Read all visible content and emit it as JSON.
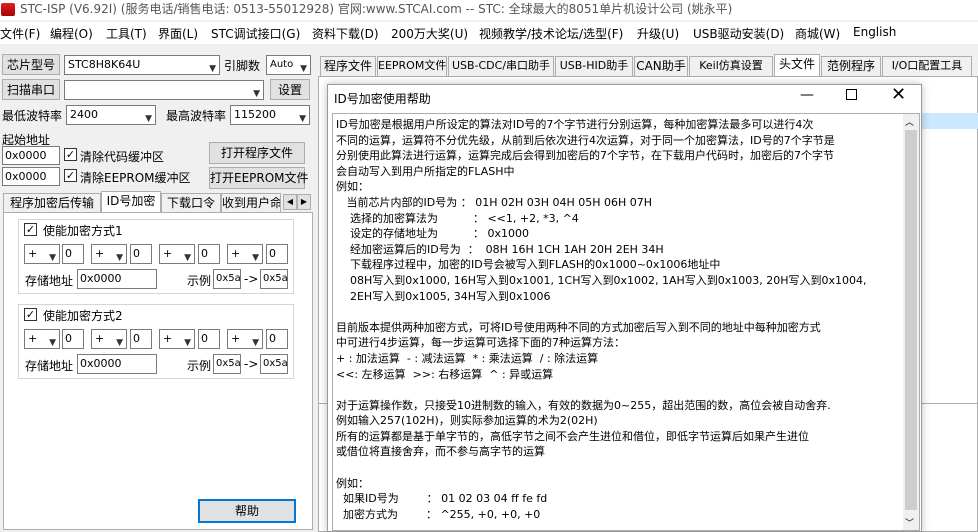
{
  "app": {
    "title": "STC-ISP (V6.92I) (服务电话/销售电话: 0513-55012928) 官网:www.STCAI.com  -- STC: 全球最大的8051单片机设计公司 (姚永平)"
  },
  "menu": [
    "文件(F)",
    "编程(O)",
    "工具(T)",
    "界面(L)",
    "STC调试接口(G)",
    "资料下载(D)",
    "200万大奖(U)",
    "视频教学/技术论坛/选型(F)",
    "升级(U)",
    "USB驱动安装(D)",
    "商城(W)",
    "English"
  ],
  "left": {
    "chip_label": "芯片型号",
    "chip_value": "STC8H8K64U",
    "pin_label": "引脚数",
    "pin_value": "Auto",
    "scan_button": "扫描串口",
    "settings_button": "设置",
    "min_baud_label": "最低波特率",
    "min_baud_value": "2400",
    "max_baud_label": "最高波特率",
    "max_baud_value": "115200",
    "start_addr_label": "起始地址",
    "addr1": "0x0000",
    "clear_code_label": "清除代码缓冲区",
    "open_program_button": "打开程序文件",
    "addr2": "0x0000",
    "clear_eeprom_label": "清除EEPROM缓冲区",
    "open_eeprom_button": "打开EEPROM文件",
    "tabs": [
      "程序加密后传输",
      "ID号加密",
      "下载口令",
      "收到用户命"
    ],
    "enc1_label": "使能加密方式1",
    "enc2_label": "使能加密方式2",
    "op_symbol": "+",
    "op_value": "0",
    "store_label": "存储地址",
    "store_value": "0x0000",
    "example_label": "示例",
    "example_in": "0x5a",
    "arrow": "->",
    "example_out": "0x5a",
    "help_button": "帮助"
  },
  "right_tabs": [
    "程序文件",
    "EEPROM文件",
    "USB-CDC/串口助手",
    "USB-HID助手",
    "CAN助手",
    "Keil仿真设置",
    "头文件",
    "范例程序",
    "I/O口配置工具"
  ],
  "dialog": {
    "title": "ID号加密使用帮助",
    "lines": [
      "ID号加密是根据用户所设定的算法对ID号的7个字节进行分别运算，每种加密算法最多可以进行4次",
      "不同的运算，运算符不分优先级，从前到后依次进行4次运算，对于同一个加密算法，ID号的7个字节是",
      "分别使用此算法进行运算，运算完成后会得到加密后的7个字节，在下载用户代码时，加密后的7个字节",
      "会自动写入到用户所指定的FLASH中",
      "例如：",
      "   当前芯片内部的ID号为 ： 01H 02H 03H 04H 05H 06H 07H",
      "    选择的加密算法为          ： <<1, +2, *3, ^4",
      "    设定的存储地址为          ： 0x1000",
      "    经加密运算后的ID号为  ：  08H 16H 1CH 1AH 20H 2EH 34H",
      "    下载程序过程中，加密的ID号会被写入到FLASH的0x1000~0x1006地址中",
      "    08H写入到0x1000, 16H写入到0x1001, 1CH写入到0x1002, 1AH写入到0x1003, 20H写入到0x1004,",
      "    2EH写入到0x1005, 34H写入到0x1006",
      "",
      "目前版本提供两种加密方式，可将ID号使用两种不同的方式加密后写入到不同的地址中每种加密方式",
      "中可进行4步运算，每一步运算可选择下面的7种运算方法：",
      "+ : 加法运算  - : 减法运算  * : 乘法运算  / : 除法运算",
      "<<: 左移运算  >>: 右移运算  ^ : 异或运算",
      "",
      "对于运算操作数，只接受10进制数的输入，有效的数据为0~255，超出范围的数，高位会被自动舍弃.",
      "例如输入257(102H)，则实际参加运算的术为2(02H)",
      "所有的运算都是基于单字节的，高低字节之间不会产生进位和借位，即低字节运算后如果产生进位",
      "或借位将直接舍弃，而不参与高字节的运算",
      "",
      "例如：",
      "  如果ID号为        ： 01 02 03 04 ff fe fd",
      "  加密方式为        ： ^255, +0, +0, +0"
    ]
  }
}
